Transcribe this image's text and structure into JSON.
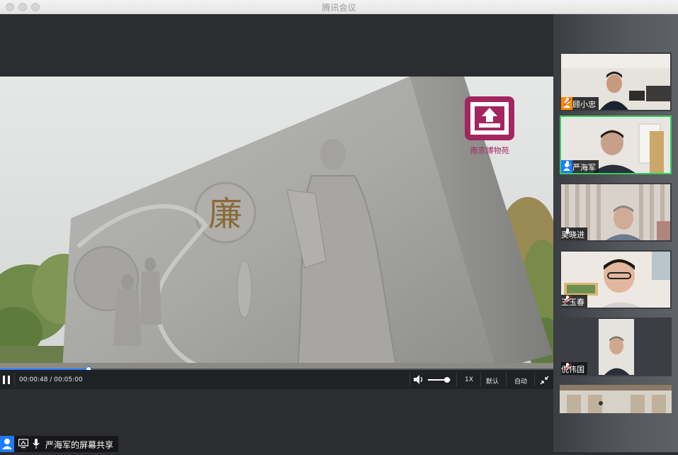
{
  "window": {
    "title": "腾讯会议"
  },
  "video": {
    "watermark_text": "南京博物苑",
    "stone_character": "廉"
  },
  "player": {
    "time_display": "00:00:48 / 00:05:00",
    "progress": 0.16,
    "volume": 0.85,
    "speed_label": "1X",
    "quality_label": "默认",
    "mode_label": "自动"
  },
  "share": {
    "label": "严海军的屏幕共享"
  },
  "participants": [
    {
      "name": "顾小忠",
      "role": "host",
      "mic": "muted",
      "active": false
    },
    {
      "name": "严海军",
      "role": "cohost",
      "mic": "on",
      "active": true
    },
    {
      "name": "吴晓进",
      "role": "",
      "mic": "on",
      "active": false
    },
    {
      "name": "王玉春",
      "role": "",
      "mic": "muted",
      "active": false
    },
    {
      "name": "倪伟国",
      "role": "",
      "mic": "muted",
      "active": false
    }
  ],
  "colors": {
    "accent": "#1e7bff",
    "speaking_border": "#2ed05c",
    "host_badge": "#ff8a00",
    "muted": "#e53935"
  },
  "icons": [
    "pause-icon",
    "volume-icon",
    "exit-fullscreen-icon",
    "screen-share-icon",
    "mic-icon",
    "mic-muted-icon",
    "user-icon"
  ]
}
